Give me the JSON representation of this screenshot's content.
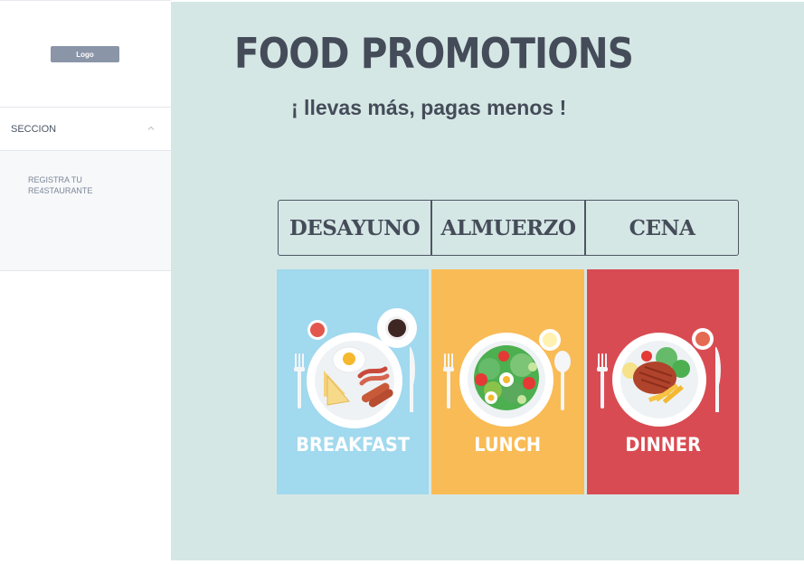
{
  "sidebar": {
    "logo_label": "Logo",
    "section_label": "SECCION",
    "section_link_label": "REGISTRA TU RE4STAURANTE"
  },
  "main": {
    "title": "FOOD PROMOTIONS",
    "subtitle": "¡ llevas más, pagas menos !",
    "tabs": [
      {
        "label": "DESAYUNO"
      },
      {
        "label": "ALMUERZO"
      },
      {
        "label": "CENA"
      }
    ],
    "cards": [
      {
        "label": "BREAKFAST",
        "color": "#a1d9ee"
      },
      {
        "label": "LUNCH",
        "color": "#f9bb55"
      },
      {
        "label": "DINNER",
        "color": "#d94b52"
      }
    ]
  },
  "colors": {
    "main_background": "#d5e7e5",
    "text_dark": "#454c59",
    "logo_button": "#8a95a8"
  }
}
